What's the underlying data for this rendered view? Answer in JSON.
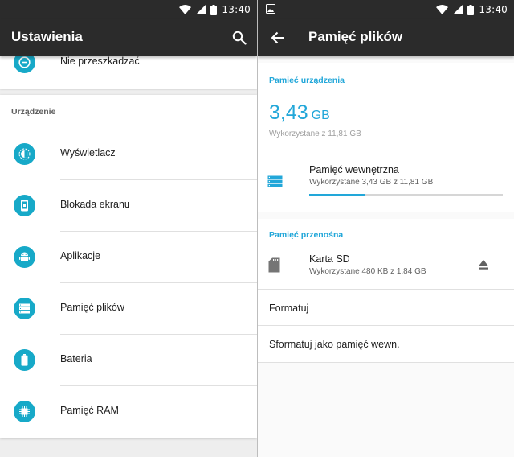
{
  "status_bar": {
    "time": "13:40"
  },
  "left_screen": {
    "title": "Ustawienia",
    "top_item": {
      "label": "Nie przeszkadzać",
      "icon": "do-not-disturb-icon"
    },
    "section_header": "Urządzenie",
    "items": [
      {
        "label": "Wyświetlacz",
        "icon": "display-icon"
      },
      {
        "label": "Blokada ekranu",
        "icon": "lock-screen-icon"
      },
      {
        "label": "Aplikacje",
        "icon": "android-icon"
      },
      {
        "label": "Pamięć plików",
        "icon": "storage-icon"
      },
      {
        "label": "Bateria",
        "icon": "battery-icon"
      },
      {
        "label": "Pamięć RAM",
        "icon": "memory-chip-icon"
      }
    ]
  },
  "right_screen": {
    "title": "Pamięć plików",
    "device_storage": {
      "header": "Pamięć urządzenia",
      "used_value": "3,43",
      "used_unit": "GB",
      "used_of": "Wykorzystane z 11,81 GB",
      "internal": {
        "title": "Pamięć wewnętrzna",
        "subtitle": "Wykorzystane 3,43 GB z 11,81 GB",
        "used_fraction": 0.29
      }
    },
    "portable_storage": {
      "header": "Pamięć przenośna",
      "sd_card": {
        "title": "Karta SD",
        "subtitle": "Wykorzystane 480 KB z 1,84 GB"
      },
      "actions": [
        "Formatuj",
        "Sformatuj jako pamięć wewn."
      ]
    }
  },
  "colors": {
    "accent": "#22a7d9",
    "icon_circle": "#17a9c8",
    "toolbar": "#2b2b2b"
  }
}
